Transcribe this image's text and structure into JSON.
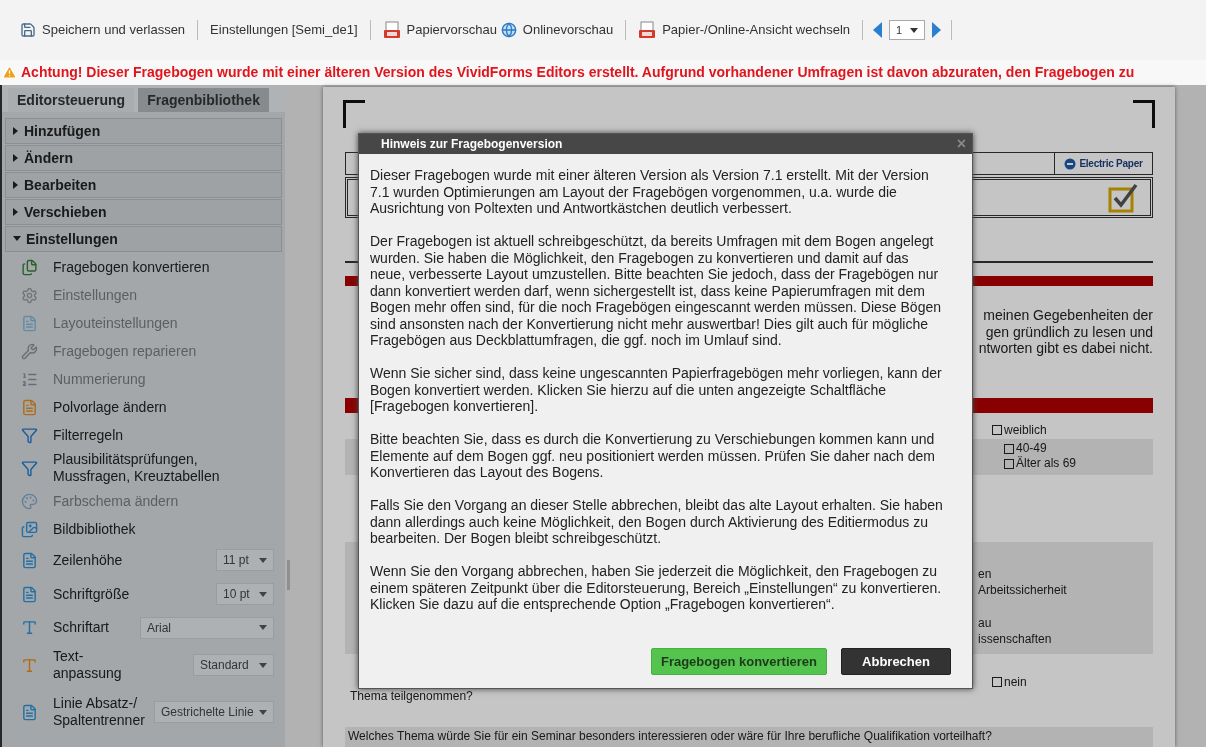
{
  "toolbar": {
    "buttons": [
      {
        "label": "Speichern und verlassen"
      },
      {
        "label": "Einstellungen [Semi_de1]"
      },
      {
        "label": "Papiervorschau"
      },
      {
        "label": "Onlinevorschau"
      },
      {
        "label": "Papier-/Online-Ansicht wechseln"
      }
    ],
    "page_select": {
      "value": "1"
    }
  },
  "warning": "Achtung! Dieser Fragebogen wurde mit einer älteren Version des VividForms Editors erstellt. Aufgrund vorhandener Umfragen ist davon abzuraten, den Fragebogen zu",
  "sidebar": {
    "tabs": [
      {
        "label": "Editorsteuerung",
        "selected": true
      },
      {
        "label": "Fragenbibliothek",
        "selected": false
      }
    ],
    "sections": [
      {
        "title": "Hinzufügen",
        "expanded": false
      },
      {
        "title": "Ändern",
        "expanded": false
      },
      {
        "title": "Bearbeiten",
        "expanded": false
      },
      {
        "title": "Verschieben",
        "expanded": false
      },
      {
        "title": "Einstellungen",
        "expanded": true,
        "items": [
          {
            "kind": "item",
            "label": "Fragebogen konvertieren",
            "disabled": false
          },
          {
            "kind": "item",
            "label": "Einstellungen",
            "disabled": true
          },
          {
            "kind": "item",
            "label": "Layouteinstellungen",
            "disabled": true
          },
          {
            "kind": "item",
            "label": "Fragebogen reparieren",
            "disabled": true
          },
          {
            "kind": "item",
            "label": "Nummerierung",
            "disabled": true
          },
          {
            "kind": "item",
            "label": "Polvorlage ändern",
            "disabled": false
          },
          {
            "kind": "item",
            "label": "Filterregeln",
            "disabled": false
          },
          {
            "kind": "item",
            "label": "Plausibilitätsprüfungen, Mussfragen, Kreuztabellen",
            "disabled": false
          },
          {
            "kind": "item",
            "label": "Farbschema ändern",
            "disabled": true
          },
          {
            "kind": "item",
            "label": "Bildbibliothek",
            "disabled": false
          },
          {
            "kind": "select",
            "label": "Zeilenhöhe",
            "value": "11 pt",
            "disabled": false
          },
          {
            "kind": "select",
            "label": "Schriftgröße",
            "value": "10 pt",
            "disabled": false
          },
          {
            "kind": "select",
            "label": "Schriftart",
            "value": "Arial",
            "disabled": false
          },
          {
            "kind": "select",
            "label": "Text-anpassung",
            "value": "Standard",
            "disabled": false
          },
          {
            "kind": "select",
            "label": "Linie Absatz-/ Spaltentrenner",
            "value": "Gestrichelte Linie",
            "disabled": false
          }
        ]
      }
    ]
  },
  "document": {
    "logo": "Electric Paper",
    "intro_lines": [
      "meinen Gegebenheiten der",
      "gen gründlich zu lesen und",
      "ntworten gibt es dabei nicht."
    ],
    "gender_option": {
      "label": "weiblich",
      "checked": false
    },
    "age_options": [
      {
        "label": "40-49",
        "checked": false
      },
      {
        "label": "Älter als 69",
        "checked": false
      }
    ],
    "topic_fragments": [
      "en",
      "Arbeitssicherheit",
      "au",
      "issenschaften"
    ],
    "yes_no": {
      "option": {
        "label": "nein",
        "checked": false
      },
      "question_end": "Thema teilgenommen?"
    },
    "next_question": "Welches Thema würde Sie für ein Seminar besonders interessieren oder wäre für Ihre berufliche Qualifikation vorteilhaft?"
  },
  "dialog": {
    "title": "Hinweis zur Fragebogenversion",
    "close": "×",
    "paragraphs": [
      "Dieser Fragebogen wurde mit einer älteren Version als Version 7.1 erstellt. Mit der Version 7.1 wurden Optimierungen am Layout der Fragebögen vorgenommen, u.a. wurde die Ausrichtung von Poltexten und Antwortkästchen deutlich verbessert.",
      "Der Fragebogen ist aktuell schreibgeschützt, da bereits Umfragen mit dem Bogen angelegt wurden. Sie haben die Möglichkeit, den Fragebogen zu konvertieren und damit auf das neue, verbesserte Layout umzustellen. Bitte beachten Sie jedoch, dass der Fragebögen nur dann konvertiert werden darf, wenn sichergestellt ist, dass keine Papierumfragen mit dem Bogen mehr offen sind, für die noch Fragebögen eingescannt werden müssen. Diese Bögen sind ansonsten nach der Konvertierung nicht mehr auswertbar! Dies gilt auch für mögliche Fragebögen aus Deckblattumfragen, die ggf. noch im Umlauf sind.",
      "Wenn Sie sicher sind, dass keine ungescannten Papierfragebögen mehr vorliegen, kann der Bogen konvertiert werden. Klicken Sie hierzu auf die unten angezeigte Schaltfläche [Fragebogen konvertieren].",
      "Bitte beachten Sie, dass es durch die Konvertierung zu Verschiebungen kommen kann und Elemente auf dem Bogen ggf. neu positioniert werden müssen. Prüfen Sie daher nach dem Konvertieren das Layout des Bogens.",
      "Falls Sie den Vorgang an dieser Stelle abbrechen, bleibt das alte Layout erhalten. Sie haben dann allerdings auch keine Möglichkeit, den Bogen durch Aktivierung des Editiermodus zu bearbeiten. Der Bogen bleibt schreibgeschützt.",
      "Wenn Sie den Vorgang abbrechen, haben Sie jederzeit die Möglichkeit, den Fragebogen zu einem späteren Zeitpunkt über die Editorsteuerung, Bereich „Einstellungen“ zu konvertieren. Klicken Sie dazu auf die entsprechende Option „Fragebogen konvertieren“."
    ],
    "buttons": [
      {
        "kind": "primary",
        "label": "Fragebogen konvertieren"
      },
      {
        "kind": "secondary",
        "label": "Abbrechen"
      }
    ]
  }
}
